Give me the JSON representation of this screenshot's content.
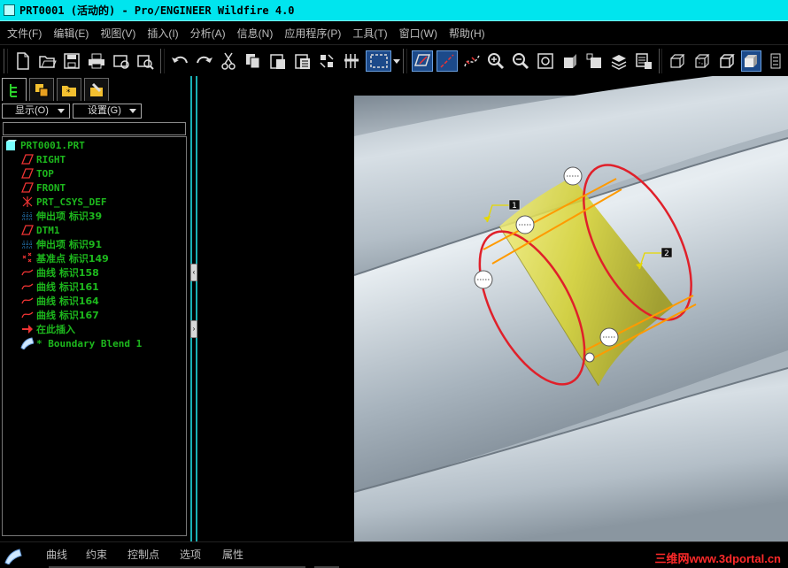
{
  "window": {
    "title": "PRT0001 (活动的) - Pro/ENGINEER Wildfire 4.0"
  },
  "menu": [
    "文件(F)",
    "编辑(E)",
    "视图(V)",
    "插入(I)",
    "分析(A)",
    "信息(N)",
    "应用程序(P)",
    "工具(T)",
    "窗口(W)",
    "帮助(H)"
  ],
  "toolbar_icons": [
    "new-file-icon",
    "open-folder-icon",
    "save-icon",
    "print-icon",
    "send-mail-icon",
    "send-mail-to-icon",
    "undo-icon",
    "redo-icon",
    "cut-icon",
    "copy-icon",
    "paste-icon",
    "paste-special-icon",
    "regenerate-icon",
    "regen-manager-icon",
    "selection-box-icon",
    "datum-plane-toggle-icon",
    "datum-axis-toggle-icon",
    "datum-curve-toggle-icon",
    "zoom-in-icon",
    "zoom-out-icon",
    "refit-icon",
    "reorient-icon",
    "saved-views-icon",
    "layers-icon",
    "view-manager-icon",
    "wireframe-icon",
    "hidden-line-icon",
    "no-hidden-icon",
    "shading-icon",
    "more-icon"
  ],
  "nav_tabs": [
    "model-tree-tab-icon",
    "layers-tab-icon",
    "favorites-tab-icon",
    "connections-tab-icon"
  ],
  "panel": {
    "show_dropdown": "显示(O)",
    "settings_dropdown": "设置(G)",
    "filter_value": ""
  },
  "model_tree": [
    {
      "label": "PRT0001.PRT",
      "icon": "part-icon",
      "indent": 0
    },
    {
      "label": "RIGHT",
      "icon": "datum-plane-icon",
      "indent": 1
    },
    {
      "label": "TOP",
      "icon": "datum-plane-icon",
      "indent": 1
    },
    {
      "label": "FRONT",
      "icon": "datum-plane-icon",
      "indent": 1
    },
    {
      "label": "PRT_CSYS_DEF",
      "icon": "coordinate-system-icon",
      "indent": 1
    },
    {
      "label": "伸出项 标识39",
      "icon": "extrude-icon",
      "indent": 1
    },
    {
      "label": "DTM1",
      "icon": "datum-plane-icon",
      "indent": 1
    },
    {
      "label": "伸出项 标识91",
      "icon": "extrude-icon",
      "indent": 1
    },
    {
      "label": "基准点 标识149",
      "icon": "datum-point-icon",
      "indent": 1
    },
    {
      "label": "曲线 标识158",
      "icon": "curve-icon",
      "indent": 1
    },
    {
      "label": "曲线 标识161",
      "icon": "curve-icon",
      "indent": 1
    },
    {
      "label": "曲线 标识164",
      "icon": "curve-icon",
      "indent": 1
    },
    {
      "label": "曲线 标识167",
      "icon": "curve-icon",
      "indent": 1
    },
    {
      "label": "在此插入",
      "icon": "insert-here-icon",
      "indent": 1
    },
    {
      "label": "* Boundary Blend 1",
      "icon": "boundary-blend-icon",
      "indent": 1
    }
  ],
  "viewport": {
    "markers": [
      "1",
      "2"
    ]
  },
  "dashboard_tabs": [
    "曲线",
    "约束",
    "控制点",
    "选项",
    "属性"
  ],
  "watermark": "三维网www.3dportal.cn",
  "colors": {
    "title_bar": "#00e5ee",
    "tree_text": "#1db81d",
    "menu_text": "#bdbdbd",
    "surface_yellow": "#d6d22e",
    "curve_red": "#e0202a",
    "watermark": "#ff2a2a"
  }
}
